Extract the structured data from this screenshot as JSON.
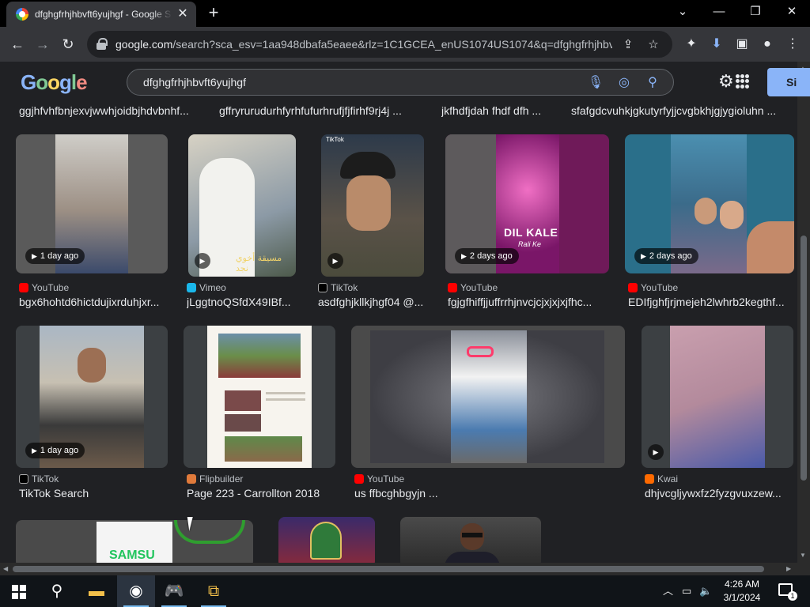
{
  "browser": {
    "tab_title": "dfghgfrhjhbvft6yujhgf - Google S",
    "url_host": "google.com",
    "url_rest": "/search?sca_esv=1aa948dbafa5eaee&rlz=1C1GCEA_enUS1074US1074&q=dfghgfrhjhbvft...",
    "window_controls": [
      "minimize",
      "maximize",
      "close"
    ]
  },
  "google": {
    "logo_text": "Google",
    "query": "dfghgfrhjhbvft6yujhgf",
    "signin_label": "Si"
  },
  "top_row_titles": [
    "ggjhfvhfbnjexvjwwhjoidbjhdvbnhf...",
    "gffryrurudurhfyrhfufurhrufjfjfirhf9rj4j ...",
    "jkfhdfjdah fhdf dfh ...",
    "sfafgdcvuhkjgkutyrfyjjcvgbkhjgjygioluhn ..."
  ],
  "row1": [
    {
      "source": "YouTube",
      "title": "bgx6hohtd6hictdujixrduhjxr...",
      "badge": "1 day ago",
      "icon": "youtube-icon"
    },
    {
      "source": "Vimeo",
      "title": "jLggtnoQSfdX49IBf...",
      "badge": "",
      "icon": "vimeo-icon",
      "overlay_text": "مسيقة أخوي نجد"
    },
    {
      "source": "TikTok",
      "title": "asdfghjkllkjhgf04 @...",
      "badge": "",
      "icon": "tiktok-icon",
      "overlay_text": "TikTok"
    },
    {
      "source": "YouTube",
      "title": "fgjgfhiffjjuffrrhjnvcjcjxjxjxjfhc...",
      "badge": "2 days ago",
      "icon": "youtube-icon",
      "overlay_text": "DIL KALE",
      "overlay_sub": "Rali Ke"
    },
    {
      "source": "YouTube",
      "title": "EDIfjghfjrjmejeh2lwhrb2kegthf...",
      "badge": "2 days ago",
      "icon": "youtube-icon"
    }
  ],
  "row2": [
    {
      "source": "TikTok",
      "title": "TikTok Search",
      "badge": "1 day ago",
      "icon": "tiktok-icon"
    },
    {
      "source": "Flipbuilder",
      "title": "Page 223 - Carrollton 2018",
      "badge": "",
      "icon": "flipbuilder-icon"
    },
    {
      "source": "YouTube",
      "title": "us ffbcghbgyjn ...",
      "badge": "",
      "icon": "youtube-icon"
    },
    {
      "source": "Kwai",
      "title": "dhjvcgljywxfz2fyzgvuxzew...",
      "badge": "",
      "icon": "kwai-icon"
    }
  ],
  "row3_overlay": "SAMSU",
  "taskbar": {
    "time": "4:26 AM",
    "date": "3/1/2024",
    "notification_count": "1"
  },
  "colors": {
    "page_bg": "#202124",
    "tab_bg": "#35363a",
    "accent_blue": "#8ab4f8",
    "youtube_red": "#ff0000"
  }
}
